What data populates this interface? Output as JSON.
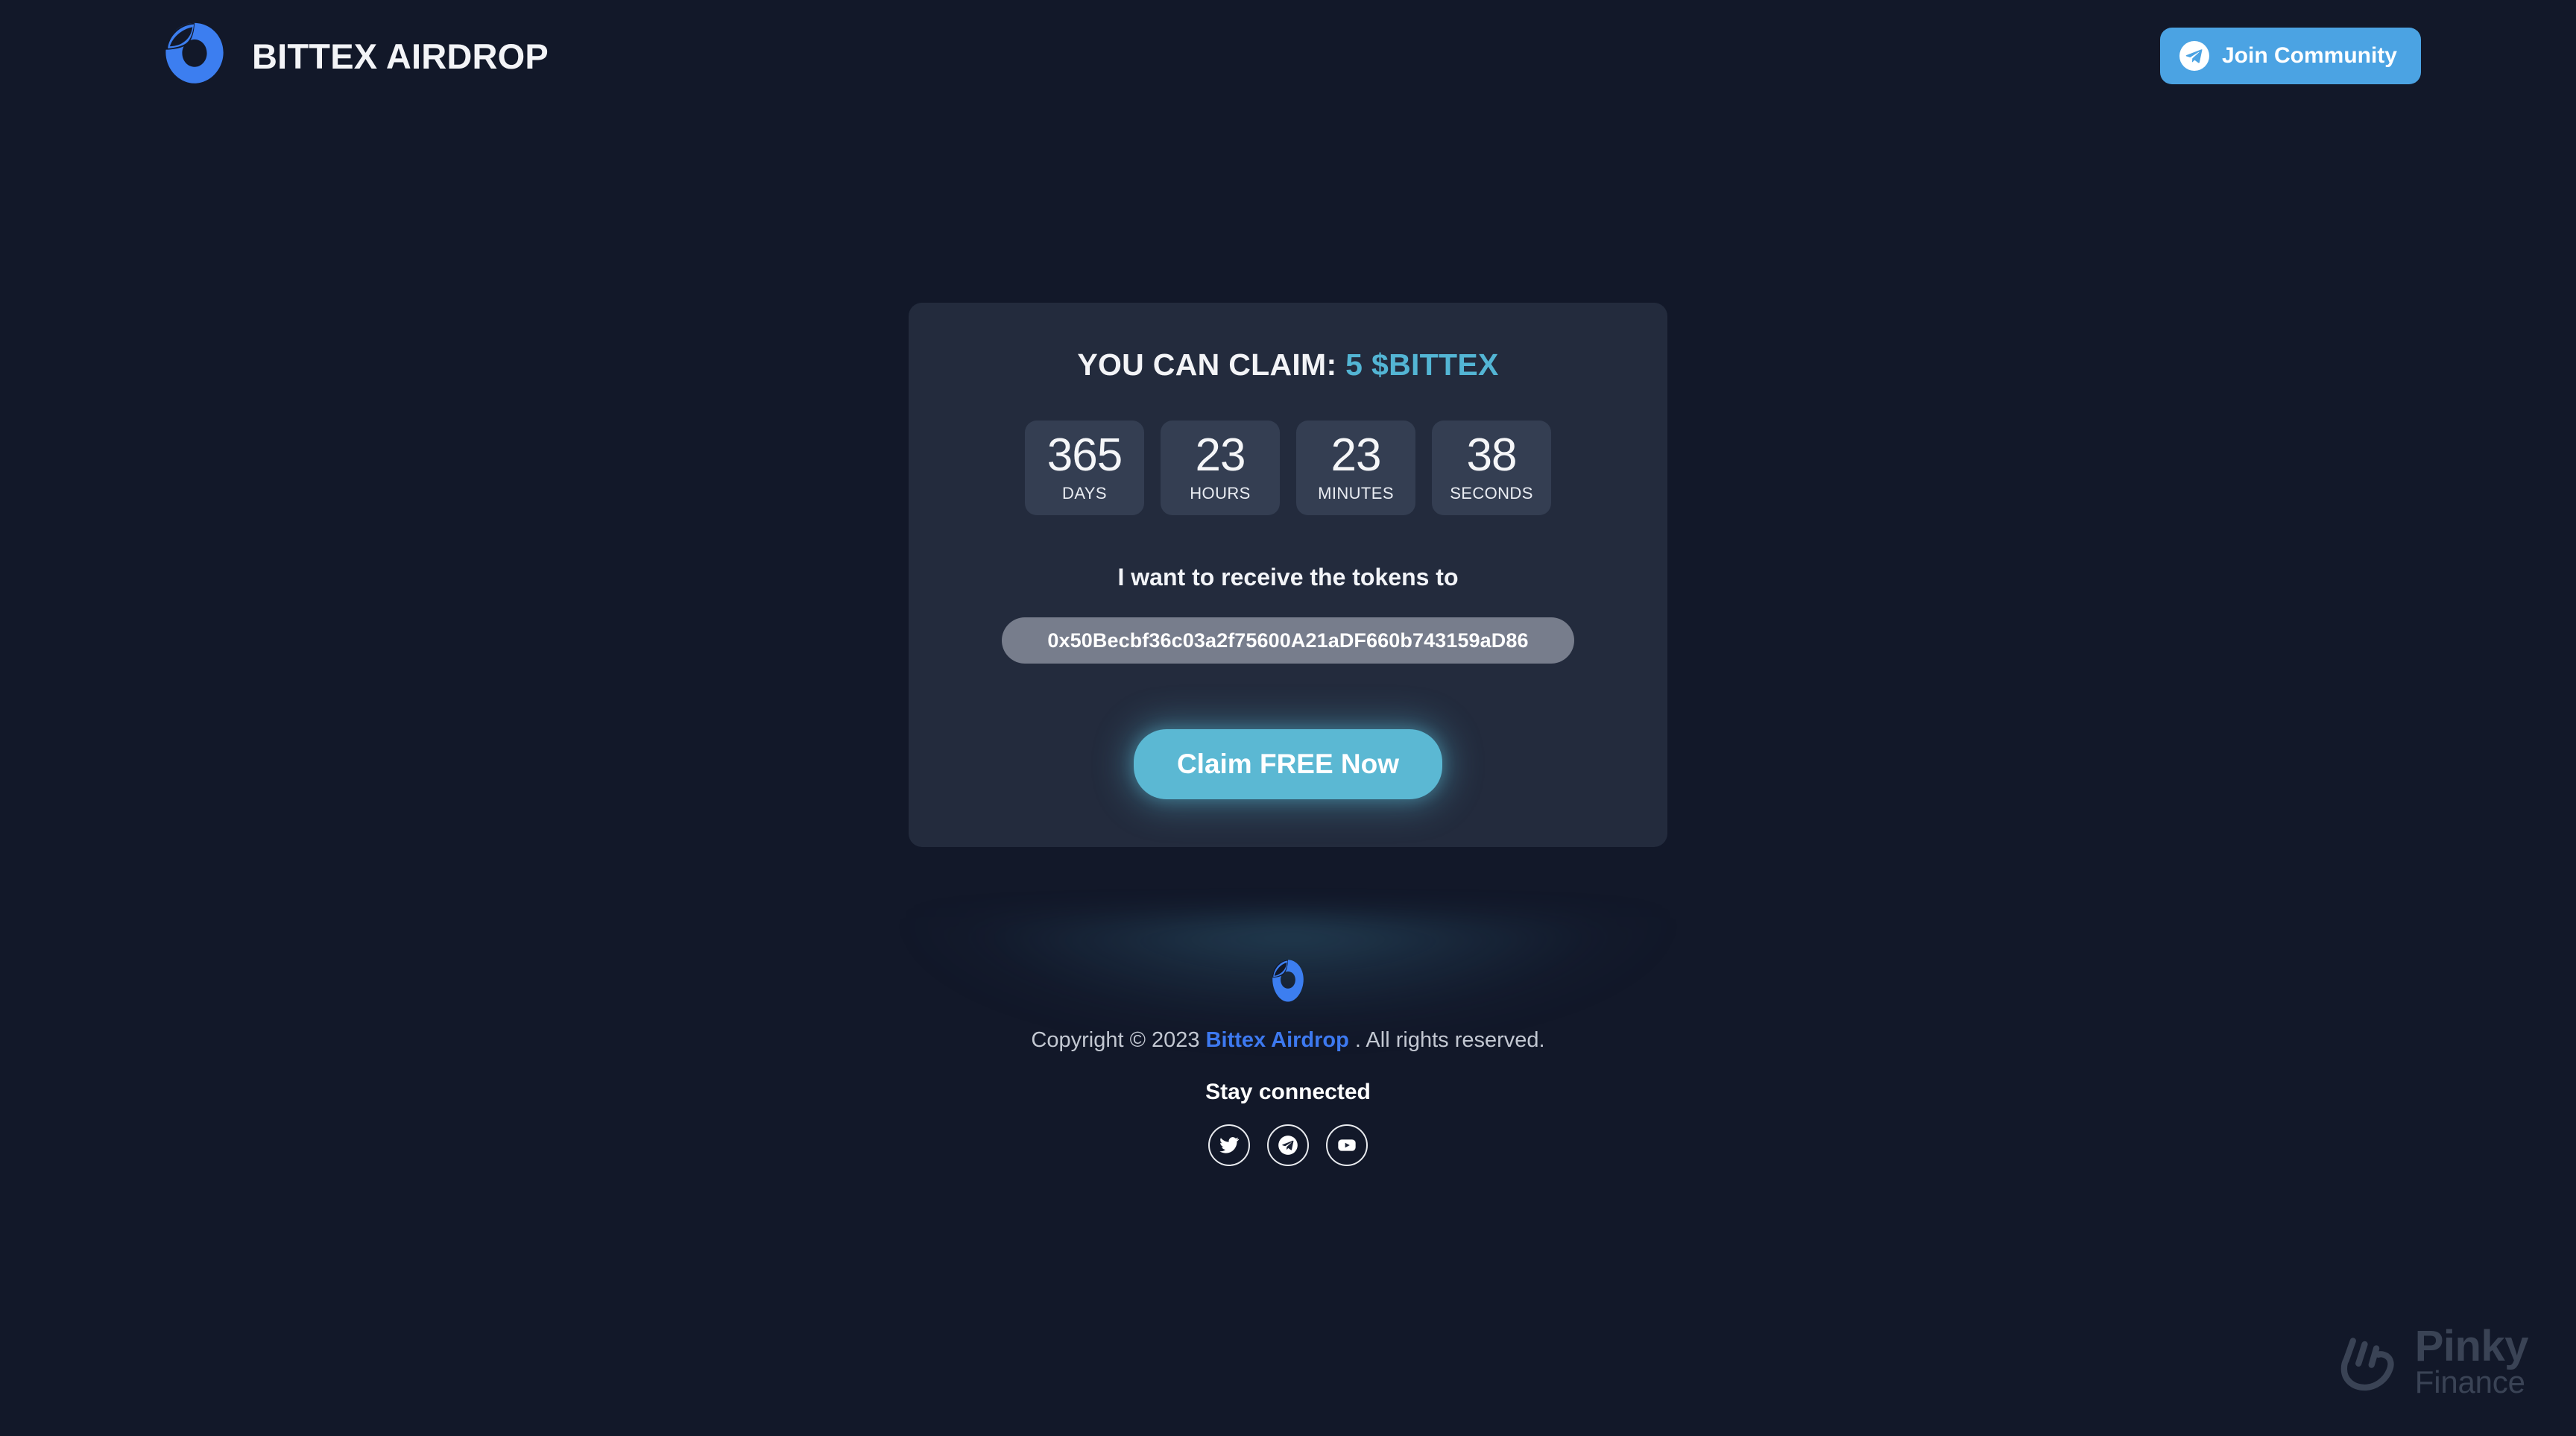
{
  "page": {
    "background_color": "#121829",
    "accent_cyan": "#53b5d4",
    "accent_blue": "#3d79f0",
    "card_color": "#232b3d"
  },
  "header": {
    "brand_title": "BITTEX AIRDROP",
    "logo_icon": "bittex-ring-logo",
    "join_button": {
      "label": "Join Community",
      "icon": "telegram-icon",
      "color": "#4ba3e3"
    }
  },
  "card": {
    "claim_heading_prefix": "YOU CAN CLAIM:",
    "claim_amount": "5 $BITTEX",
    "countdown": [
      {
        "value": "365",
        "label": "DAYS"
      },
      {
        "value": "23",
        "label": "HOURS"
      },
      {
        "value": "23",
        "label": "MINUTES"
      },
      {
        "value": "38",
        "label": "SECONDS"
      }
    ],
    "receive_label": "I want to receive the tokens to",
    "address_value": "0x50Becbf36c03a2f75600A21aDF660b743159aD86",
    "address_placeholder": "0x50Becbf36c03a2f75600A21aDF660b743159aD86",
    "claim_button_label": "Claim FREE Now"
  },
  "footer": {
    "logo_icon": "bittex-ring-logo",
    "copyright_prefix": "Copyright © 2023",
    "copyright_link": "Bittex Airdrop",
    "copyright_suffix": ". All rights reserved.",
    "stay_connected_label": "Stay connected",
    "socials": [
      {
        "name": "twitter",
        "icon": "twitter-icon"
      },
      {
        "name": "telegram",
        "icon": "telegram-icon"
      },
      {
        "name": "youtube",
        "icon": "youtube-icon"
      }
    ]
  },
  "watermark": {
    "icon": "pinky-hand-icon",
    "primary": "Pinky",
    "secondary": "Finance"
  }
}
